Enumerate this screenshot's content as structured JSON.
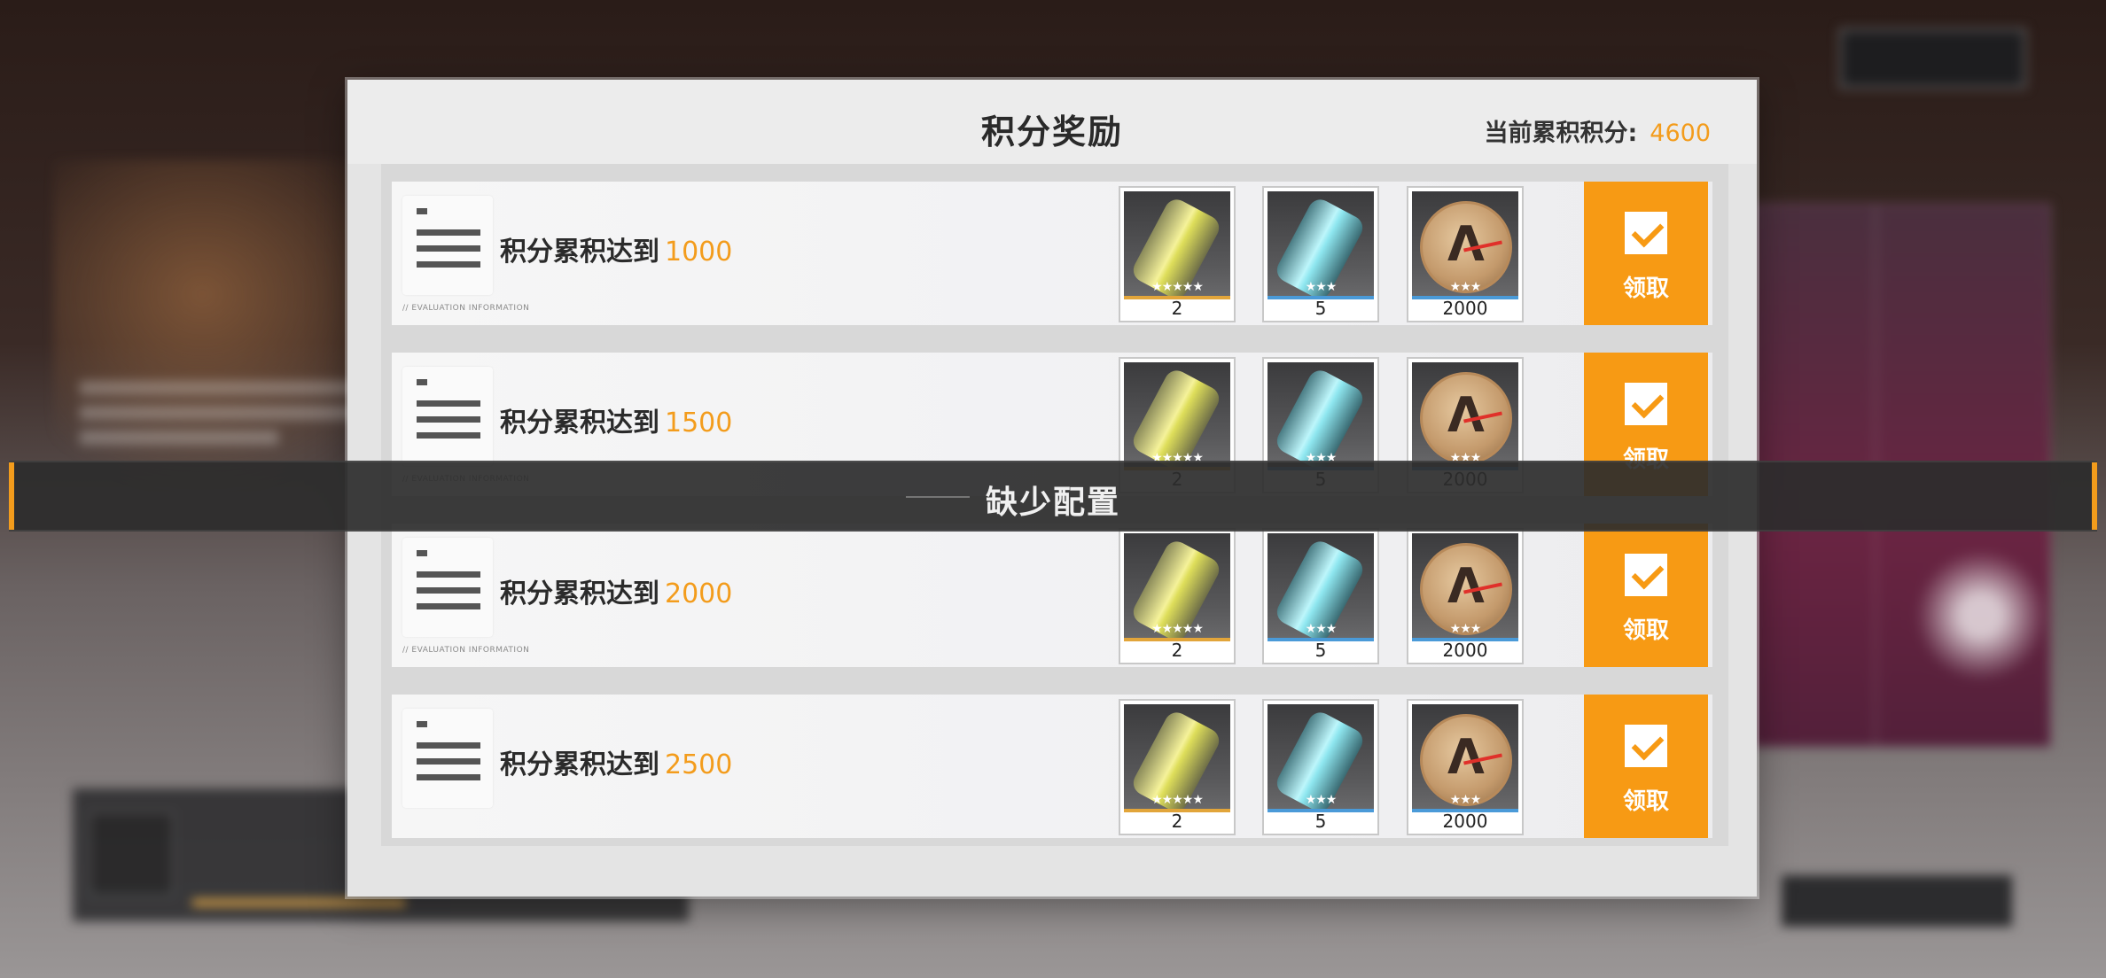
{
  "dialog": {
    "title": "积分奖励",
    "points_label": "当前累积积分:",
    "points_value": "4600"
  },
  "rows": [
    {
      "label": "积分累积达到",
      "threshold": "1000",
      "eval": "// EVALUATION INFORMATION",
      "items": [
        {
          "icon": "gold-crystal-icon",
          "stars": "★★★★★",
          "qty": "2"
        },
        {
          "icon": "cyan-crystal-icon",
          "stars": "★★★",
          "qty": "5"
        },
        {
          "icon": "coin-icon",
          "stars": "★★★",
          "qty": "2000"
        }
      ],
      "claim": "领取"
    },
    {
      "label": "积分累积达到",
      "threshold": "1500",
      "eval": "// EVALUATION INFORMATION",
      "items": [
        {
          "icon": "gold-crystal-icon",
          "stars": "★★★★★",
          "qty": "2"
        },
        {
          "icon": "cyan-crystal-icon",
          "stars": "★★★",
          "qty": "5"
        },
        {
          "icon": "coin-icon",
          "stars": "★★★",
          "qty": "2000"
        }
      ],
      "claim": "领取"
    },
    {
      "label": "积分累积达到",
      "threshold": "2000",
      "eval": "// EVALUATION INFORMATION",
      "items": [
        {
          "icon": "gold-crystal-icon",
          "stars": "★★★★★",
          "qty": "2"
        },
        {
          "icon": "cyan-crystal-icon",
          "stars": "★★★",
          "qty": "5"
        },
        {
          "icon": "coin-icon",
          "stars": "★★★",
          "qty": "2000"
        }
      ],
      "claim": "领取"
    },
    {
      "label": "积分累积达到",
      "threshold": "2500",
      "eval": "",
      "items": [
        {
          "icon": "gold-crystal-icon",
          "stars": "★★★★★",
          "qty": "2"
        },
        {
          "icon": "cyan-crystal-icon",
          "stars": "★★★",
          "qty": "5"
        },
        {
          "icon": "coin-icon",
          "stars": "★★★",
          "qty": "2000"
        }
      ],
      "claim": "领取"
    }
  ],
  "toast": {
    "message": "缺少配置"
  },
  "colors": {
    "accent": "#f39c1c",
    "claim_button": "#f79a14"
  }
}
